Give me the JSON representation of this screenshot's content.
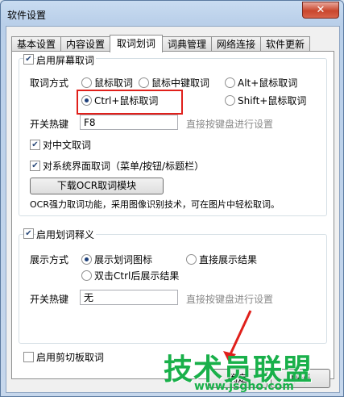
{
  "window": {
    "title": "软件设置",
    "close": "✕"
  },
  "tabs": [
    "基本设置",
    "内容设置",
    "取词划词",
    "词典管理",
    "网络连接",
    "软件更新"
  ],
  "screen_capture": {
    "enable_label": "启用屏幕取词",
    "method_label": "取词方式",
    "methods": [
      "鼠标取词",
      "鼠标中键取词",
      "Alt+鼠标取词",
      "Ctrl+鼠标取词",
      "Shift+鼠标取词"
    ],
    "hotkey_label": "开关热键",
    "hotkey_value": "F8",
    "hotkey_hint": "直接按键盘进行设置",
    "chinese_label": "对中文取词",
    "system_ui_label": "对系统界面取词（菜单/按钮/标题栏）",
    "ocr_button": "下载OCR取词模块",
    "ocr_note": "OCR强力取词功能，采用图像识别技术，可在图片中轻松取词。"
  },
  "selection": {
    "enable_label": "启用划词释义",
    "display_label": "展示方式",
    "options": [
      "展示划词图标",
      "直接展示结果",
      "双击Ctrl后展示结果"
    ],
    "hotkey_label": "开关热键",
    "hotkey_value": "无",
    "hotkey_hint": "直接按键盘进行设置"
  },
  "clipboard": {
    "enable_label": "启用剪切板取词"
  },
  "footer": {
    "ok_label": "确定",
    "cancel_label": "取消"
  },
  "watermark": {
    "text": "技术员联盟",
    "url": "www.jsgho.com"
  },
  "colors": {
    "highlight": "#e0201b",
    "watermark": "#19b04a",
    "titlebar": "#c9dcf1"
  }
}
